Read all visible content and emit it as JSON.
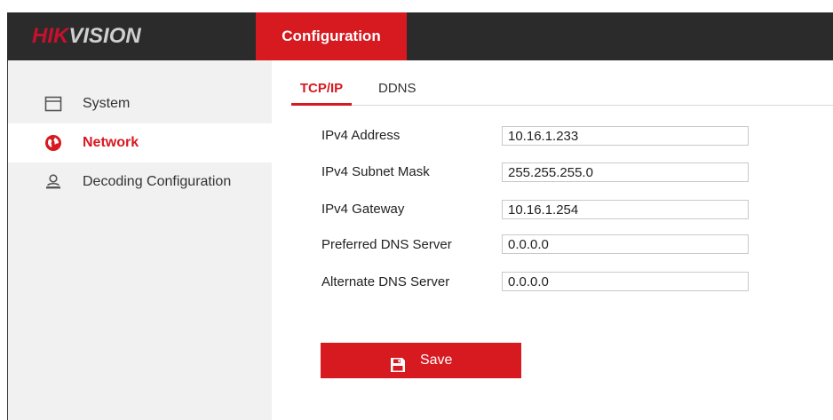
{
  "header": {
    "logo_red": "HIK",
    "logo_gray": "VISION",
    "active_tab": "Configuration"
  },
  "sidebar": {
    "items": [
      {
        "label": "System",
        "icon": "window-icon",
        "active": false
      },
      {
        "label": "Network",
        "icon": "globe-icon",
        "active": true
      },
      {
        "label": "Decoding Configuration",
        "icon": "user-monitor-icon",
        "active": false
      }
    ]
  },
  "subtabs": [
    {
      "label": "TCP/IP",
      "active": true
    },
    {
      "label": "DDNS",
      "active": false
    }
  ],
  "form": {
    "fields": [
      {
        "label": "IPv4 Address",
        "value": "10.16.1.233"
      },
      {
        "label": "IPv4 Subnet Mask",
        "value": "255.255.255.0"
      },
      {
        "label": "IPv4 Gateway",
        "value": "10.16.1.254"
      },
      {
        "label": "Preferred DNS Server",
        "value": "0.0.0.0"
      },
      {
        "label": "Alternate DNS Server",
        "value": "0.0.0.0"
      }
    ],
    "save_label": "Save",
    "save_icon": "floppy-disk-icon"
  },
  "colors": {
    "accent": "#d71920",
    "topbar": "#2b2b2b",
    "sidebar_bg": "#f1f1f1"
  }
}
